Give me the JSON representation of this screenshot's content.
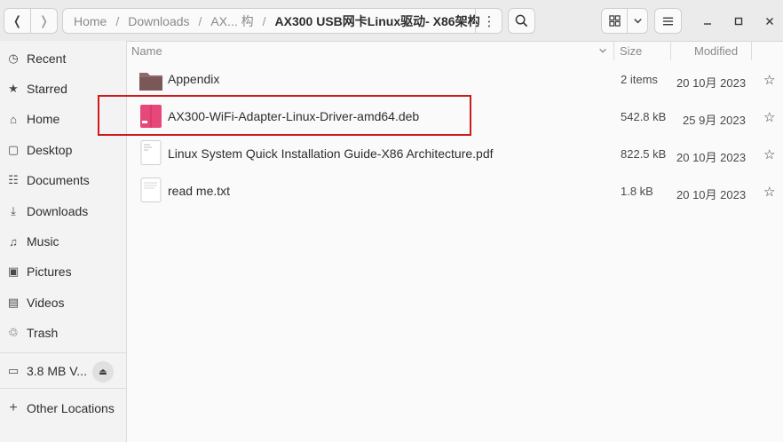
{
  "header": {
    "back_icon": "chevron-left-icon",
    "forward_icon": "chevron-right-icon",
    "breadcrumb": {
      "home": "Home",
      "downloads": "Downloads",
      "middle": "AX... 构",
      "current": "AX300 USB网卡Linux驱动- X86架构",
      "separator": "/"
    },
    "path_menu_icon": "vertical-dots-icon",
    "search_icon": "search-icon",
    "view_icon": "grid-view-icon",
    "view_dropdown_icon": "chevron-down-icon",
    "menu_icon": "hamburger-menu-icon",
    "window_controls": [
      "minimize-icon",
      "maximize-icon",
      "close-icon"
    ]
  },
  "sidebar": {
    "items": [
      {
        "label": "Recent",
        "icon": "clock-icon"
      },
      {
        "label": "Starred",
        "icon": "star-icon"
      },
      {
        "label": "Home",
        "icon": "home-icon"
      },
      {
        "label": "Desktop",
        "icon": "desktop-icon"
      },
      {
        "label": "Documents",
        "icon": "document-icon"
      },
      {
        "label": "Downloads",
        "icon": "download-icon"
      },
      {
        "label": "Music",
        "icon": "music-icon"
      },
      {
        "label": "Pictures",
        "icon": "picture-icon"
      },
      {
        "label": "Videos",
        "icon": "video-icon"
      },
      {
        "label": "Trash",
        "icon": "trash-icon"
      }
    ],
    "volume": {
      "label": "3.8 MB V...",
      "icon": "drive-icon",
      "eject_icon": "eject-icon"
    },
    "other_locations": {
      "label": "Other Locations",
      "icon": "plus-icon"
    }
  },
  "columns": {
    "name": "Name",
    "size": "Size",
    "modified": "Modified",
    "sort_icon": "chevron-down-icon"
  },
  "files": [
    {
      "name": "Appendix",
      "size": "2 items",
      "modified": "20 10月 2023",
      "type": "folder",
      "icon": "folder-icon"
    },
    {
      "name": "AX300-WiFi-Adapter-Linux-Driver-amd64.deb",
      "size": "542.8 kB",
      "modified": "25 9月 2023",
      "type": "deb",
      "icon": "deb-package-icon"
    },
    {
      "name": "Linux System Quick Installation Guide-X86 Architecture.pdf",
      "size": "822.5 kB",
      "modified": "20 10月 2023",
      "type": "pdf",
      "icon": "pdf-document-icon"
    },
    {
      "name": "read me.txt",
      "size": "1.8 kB",
      "modified": "20 10月 2023",
      "type": "txt",
      "icon": "text-file-icon"
    }
  ],
  "colors": {
    "highlight_box": "#cc1b1b",
    "folder": "#8f6a6a",
    "deb_package": "#e8477a"
  }
}
